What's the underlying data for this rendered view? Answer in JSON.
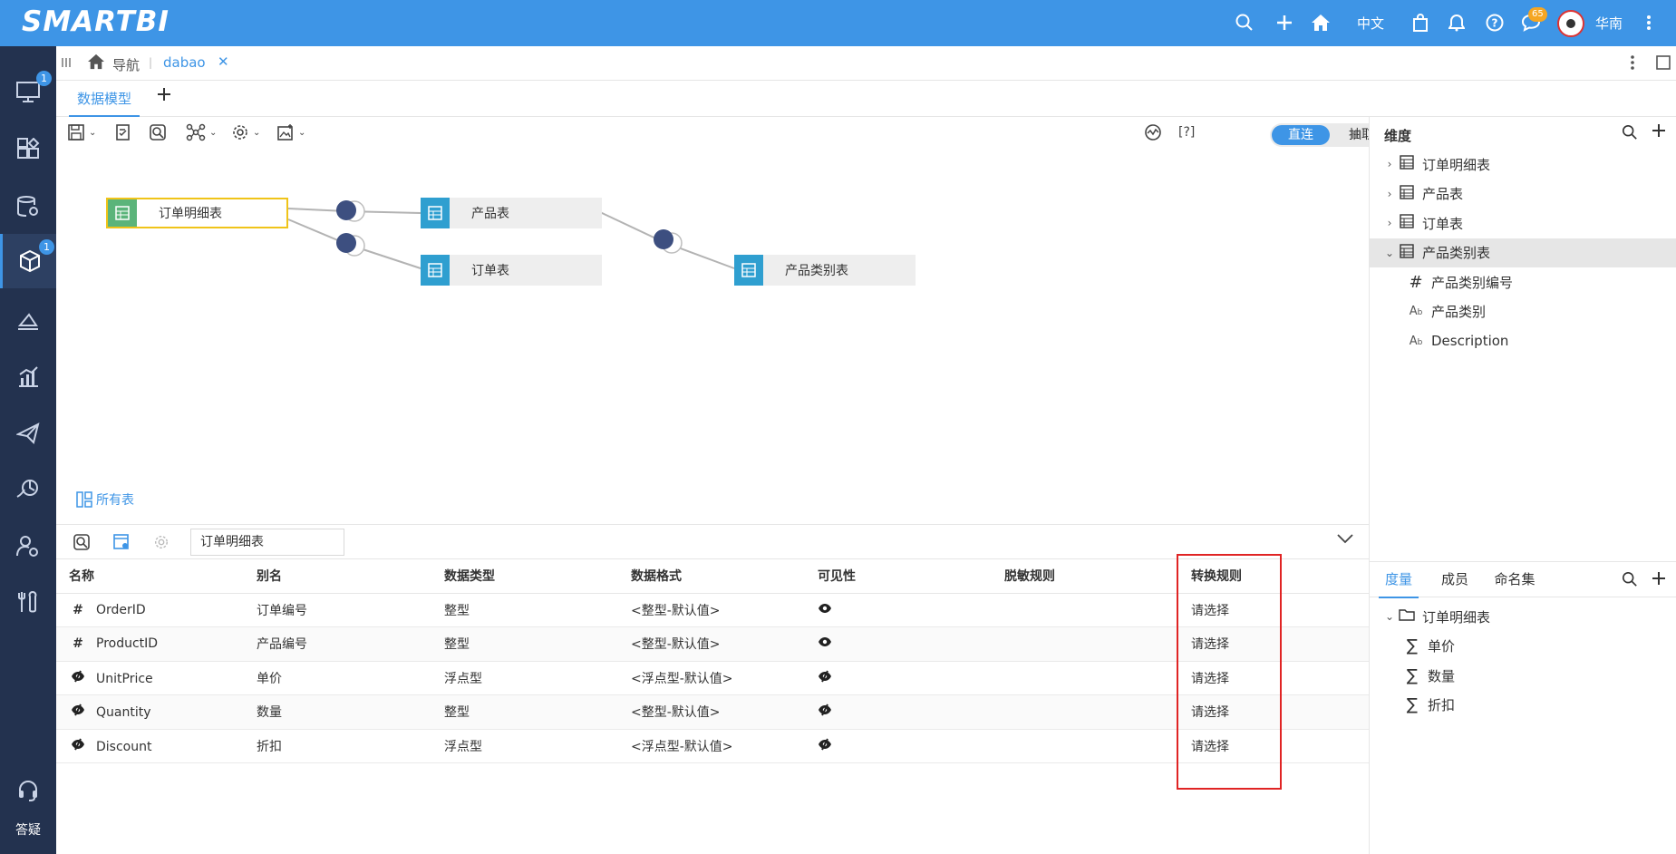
{
  "app": {
    "logo": "SMARTBI",
    "lang": "中文",
    "notify_count": "65",
    "user": "华南"
  },
  "sidebar": {
    "badges": [
      "1",
      "1"
    ],
    "help_label": "答疑"
  },
  "navbar": {
    "nav_label": "导航",
    "tab_label": "dabao"
  },
  "model_tabs": {
    "active": "数据模型"
  },
  "canvas": {
    "help": "[?]",
    "mode_on": "直连",
    "mode_off": "抽取",
    "all_tables": "所有表",
    "nodes": [
      "订单明细表",
      "产品表",
      "订单表",
      "产品类别表"
    ]
  },
  "bottom": {
    "table_name": "订单明细表",
    "columns": [
      "名称",
      "别名",
      "数据类型",
      "数据格式",
      "可见性",
      "脱敏规则",
      "转换规则"
    ],
    "rows": [
      {
        "icon": "#",
        "name": "OrderID",
        "alias": "订单编号",
        "type": "整型",
        "format": "<整型-默认值>",
        "rule": "请选择"
      },
      {
        "icon": "#",
        "name": "ProductID",
        "alias": "产品编号",
        "type": "整型",
        "format": "<整型-默认值>",
        "rule": "请选择"
      },
      {
        "icon": "eye",
        "name": "UnitPrice",
        "alias": "单价",
        "type": "浮点型",
        "format": "<浮点型-默认值>",
        "rule": "请选择"
      },
      {
        "icon": "eye",
        "name": "Quantity",
        "alias": "数量",
        "type": "整型",
        "format": "<整型-默认值>",
        "rule": "请选择"
      },
      {
        "icon": "eye",
        "name": "Discount",
        "alias": "折扣",
        "type": "浮点型",
        "format": "<浮点型-默认值>",
        "rule": "请选择"
      }
    ]
  },
  "right_panel": {
    "dimension_title": "维度",
    "dimension_tree": [
      {
        "label": "订单明细表",
        "level": 0,
        "kind": "table",
        "expanded": false
      },
      {
        "label": "产品表",
        "level": 0,
        "kind": "table",
        "expanded": false
      },
      {
        "label": "订单表",
        "level": 0,
        "kind": "table",
        "expanded": false
      },
      {
        "label": "产品类别表",
        "level": 0,
        "kind": "table",
        "expanded": true
      },
      {
        "label": "产品类别编号",
        "level": 1,
        "kind": "#"
      },
      {
        "label": "产品类别",
        "level": 1,
        "kind": "Ab"
      },
      {
        "label": "Description",
        "level": 1,
        "kind": "Ab"
      }
    ],
    "tabs": [
      "度量",
      "成员",
      "命名集"
    ],
    "measure_tree": [
      {
        "label": "订单明细表",
        "level": 0,
        "kind": "folder"
      },
      {
        "label": "单价",
        "level": 1,
        "kind": "sigma"
      },
      {
        "label": "数量",
        "level": 1,
        "kind": "sigma"
      },
      {
        "label": "折扣",
        "level": 1,
        "kind": "sigma"
      }
    ]
  },
  "colors": {
    "topbar": "#3e95e6",
    "sidebar": "#23324f",
    "accent": "#3e95e6",
    "highlight_box": "#e02424"
  }
}
